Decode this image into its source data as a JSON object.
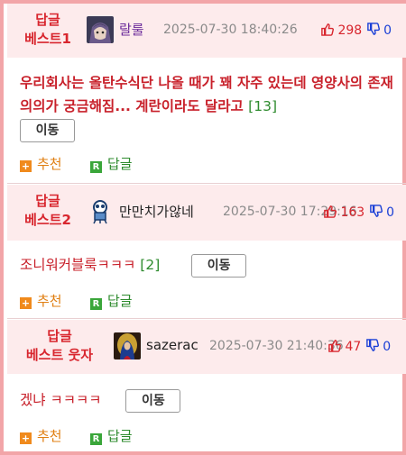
{
  "comments": [
    {
      "best_line1": "답글",
      "best_line2": "베스트1",
      "username": "랄룰",
      "datetime": "2025-07-30 18:40:26",
      "upvotes": "298",
      "downvotes": "0",
      "content": "우리회사는 올탄수식단 나올 때가 꽤 자주 있는데 영양사의 존재의의가 궁금해짐... 계란이라도 달라고",
      "reply_count": "[13]",
      "move_label": "이동",
      "recommend_label": "추천",
      "reply_label": "답글"
    },
    {
      "best_line1": "답글",
      "best_line2": "베스트2",
      "username": "만만치가않네",
      "datetime": "2025-07-30 17:29:16",
      "upvotes": "163",
      "downvotes": "0",
      "content": "조니워커블룩ㅋㅋㅋ",
      "reply_count": "[2]",
      "move_label": "이동",
      "recommend_label": "추천",
      "reply_label": "답글"
    },
    {
      "best_line1": "답글",
      "best_line2": "베스트 웃자",
      "username": "sazerac",
      "datetime": "2025-07-30 21:40:36",
      "upvotes": "47",
      "downvotes": "0",
      "content": "겠냐 ㅋㅋㅋㅋ",
      "reply_count": "",
      "move_label": "이동",
      "recommend_label": "추천",
      "reply_label": "답글"
    }
  ],
  "icons": {
    "recommend": "plus-square-icon",
    "reply": "r-square-icon",
    "upvote": "thumbs-up-icon",
    "downvote": "thumbs-down-icon"
  },
  "colors": {
    "accent_red": "#d8262e",
    "down_blue": "#1a3fd6",
    "reply_green": "#2e8b2e",
    "recommend_orange": "#e07f12",
    "header_bg": "#fdebec",
    "border": "#f2a5a8"
  }
}
